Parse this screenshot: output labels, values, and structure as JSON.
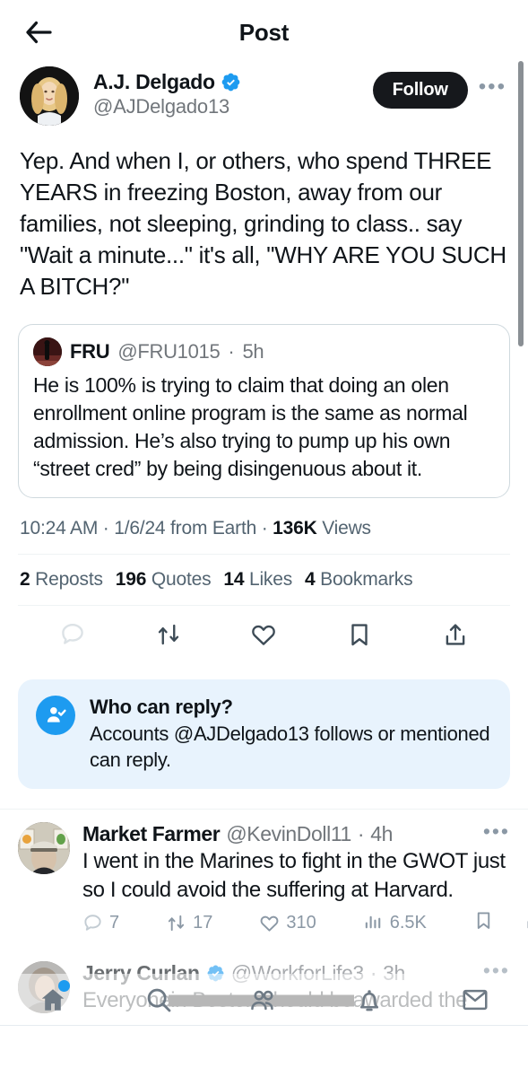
{
  "header": {
    "title": "Post",
    "back_icon": "arrow-left-icon"
  },
  "post": {
    "author": {
      "display_name": "A.J. Delgado",
      "handle": "@AJDelgado13",
      "verified": true,
      "verified_color": "#1d9bf0"
    },
    "follow_label": "Follow",
    "more_label": "•••",
    "text": "Yep. And when I, or others, who spend THREE YEARS in freezing Boston, away from our families, not sleeping, grinding to class.. say \"Wait a minute...\" it's all, \"WHY ARE YOU SUCH A BITCH?\"",
    "quoted": {
      "display_name": "FRU",
      "handle": "@FRU1015",
      "separator": "·",
      "time": "5h",
      "text": "He is 100% is trying to claim that doing an olen enrollment online program is the same as normal admission. He’s also trying to pump up his own “street cred” by being disingenuous about it."
    },
    "meta": {
      "time": "10:24 AM",
      "dot1": "·",
      "date": "1/6/24 from Earth",
      "dot2": "·",
      "views_count": "136K",
      "views_label": "Views"
    },
    "stats": [
      {
        "count": "2",
        "label": "Reposts"
      },
      {
        "count": "196",
        "label": "Quotes"
      },
      {
        "count": "14",
        "label": "Likes"
      },
      {
        "count": "4",
        "label": "Bookmarks"
      }
    ],
    "actions": [
      {
        "name": "reply-icon"
      },
      {
        "name": "repost-icon"
      },
      {
        "name": "like-icon"
      },
      {
        "name": "bookmark-icon"
      },
      {
        "name": "share-icon"
      }
    ]
  },
  "reply_notice": {
    "icon": "person-check-icon",
    "title": "Who can reply?",
    "text": "Accounts @AJDelgado13 follows or mentioned can reply.",
    "background": "#e8f3fd",
    "icon_color": "#1d9bf0"
  },
  "replies": [
    {
      "display_name": "Market Farmer",
      "handle": "@KevinDoll11",
      "separator": "·",
      "time": "4h",
      "verified": false,
      "more_label": "•••",
      "text": "I went in the Marines to fight in the GWOT just so I could avoid the suffering at Harvard.",
      "metrics": {
        "replies": "7",
        "reposts": "17",
        "likes": "310",
        "views": "6.5K"
      }
    },
    {
      "display_name": "Jerry Curlan",
      "handle": "@WorkforLife3",
      "separator": "·",
      "time": "3h",
      "verified": true,
      "more_label": "•••",
      "text_before": "Everyone",
      "text_redacted": "in Boston should be",
      "text_after": "awarded the"
    }
  ],
  "bottom_nav": [
    {
      "name": "home-icon",
      "badge": true
    },
    {
      "name": "search-icon",
      "badge": false
    },
    {
      "name": "communities-icon",
      "badge": false
    },
    {
      "name": "notifications-icon",
      "badge": false
    },
    {
      "name": "messages-icon",
      "badge": false
    }
  ]
}
